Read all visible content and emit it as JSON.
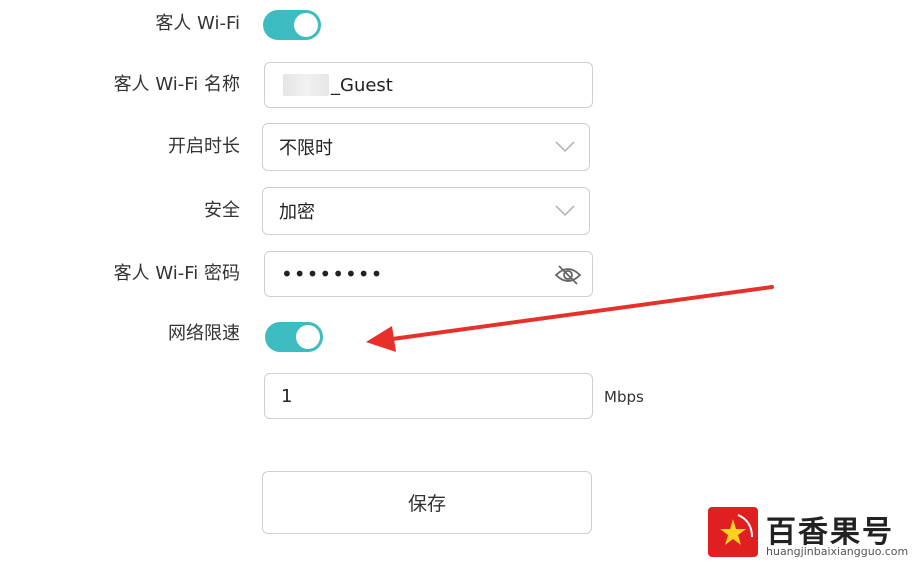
{
  "guest_wifi": {
    "label": "客人 Wi-Fi",
    "enabled": true
  },
  "ssid": {
    "label": "客人 Wi-Fi 名称",
    "value_suffix": "_Guest"
  },
  "duration": {
    "label": "开启时长",
    "value": "不限时"
  },
  "security": {
    "label": "安全",
    "value": "加密"
  },
  "password": {
    "label": "客人 Wi-Fi 密码",
    "value": "••••••••"
  },
  "rate_limit": {
    "label": "网络限速",
    "enabled": true,
    "value": "1",
    "unit": "Mbps"
  },
  "save_button": {
    "label": "保存"
  },
  "watermark": {
    "brand": "百香果号",
    "url": "huangjinbaixiangguo.com"
  },
  "colors": {
    "toggle_on": "#3cbcc0",
    "arrow": "#e8302a",
    "border": "#cfcfcf"
  }
}
